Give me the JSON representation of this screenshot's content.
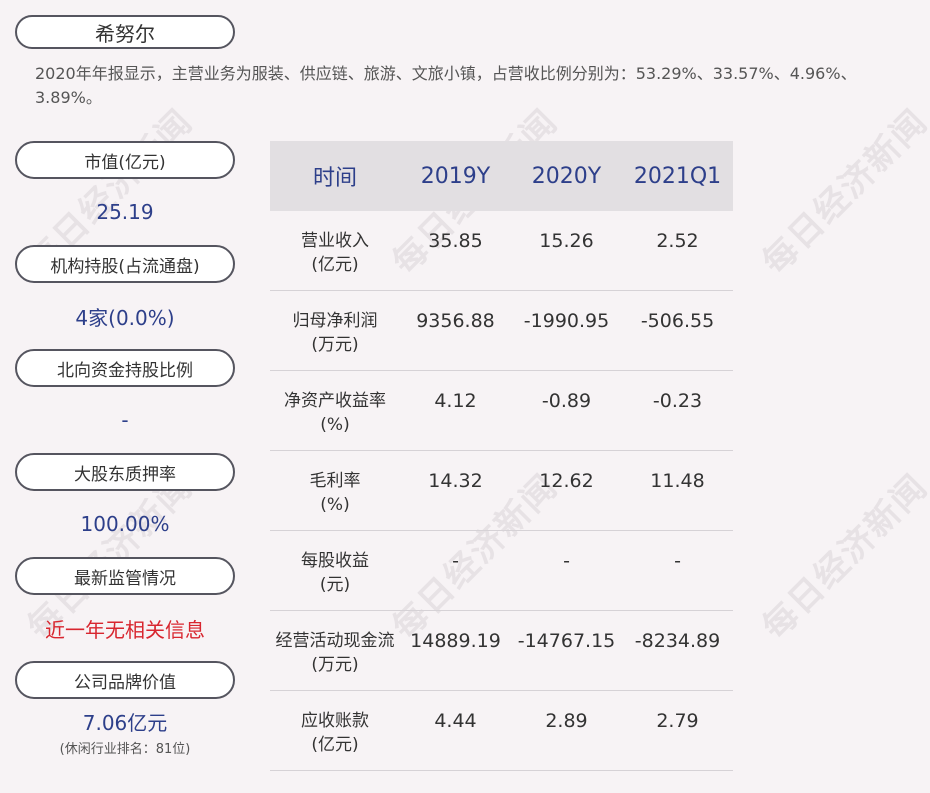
{
  "watermark": "每日经济新闻",
  "company": "希努尔",
  "summary": "2020年年报显示，主营业务为服装、供应链、旅游、文旅小镇，占营收比例分别为：53.29%、33.57%、4.96%、3.89%。",
  "metrics": [
    {
      "label": "市值(亿元)",
      "value": "25.19"
    },
    {
      "label": "机构持股(占流通盘)",
      "value": "4家(0.0%)"
    },
    {
      "label": "北向资金持股比例",
      "value": "-"
    },
    {
      "label": "大股东质押率",
      "value": "100.00%"
    },
    {
      "label": "最新监管情况",
      "value": "近一年无相关信息"
    },
    {
      "label": "公司品牌价值",
      "value": "7.06亿元",
      "sub": "(休闲行业排名：81位)"
    }
  ],
  "table": {
    "header": [
      "时间",
      "2019Y",
      "2020Y",
      "2021Q1"
    ],
    "rows": [
      {
        "name": "营业收入",
        "unit": "(亿元)",
        "values": [
          "35.85",
          "15.26",
          "2.52"
        ]
      },
      {
        "name": "归母净利润",
        "unit": "(万元)",
        "values": [
          "9356.88",
          "-1990.95",
          "-506.55"
        ]
      },
      {
        "name": "净资产收益率",
        "unit": "(%)",
        "values": [
          "4.12",
          "-0.89",
          "-0.23"
        ]
      },
      {
        "name": "毛利率",
        "unit": "(%)",
        "values": [
          "14.32",
          "12.62",
          "11.48"
        ]
      },
      {
        "name": "每股收益",
        "unit": "(元)",
        "values": [
          "-",
          "-",
          "-"
        ]
      },
      {
        "name": "经营活动现金流",
        "unit": "(万元)",
        "values": [
          "14889.19",
          "-14767.15",
          "-8234.89"
        ]
      },
      {
        "name": "应收账款",
        "unit": "(亿元)",
        "values": [
          "4.44",
          "2.89",
          "2.79"
        ]
      }
    ]
  }
}
